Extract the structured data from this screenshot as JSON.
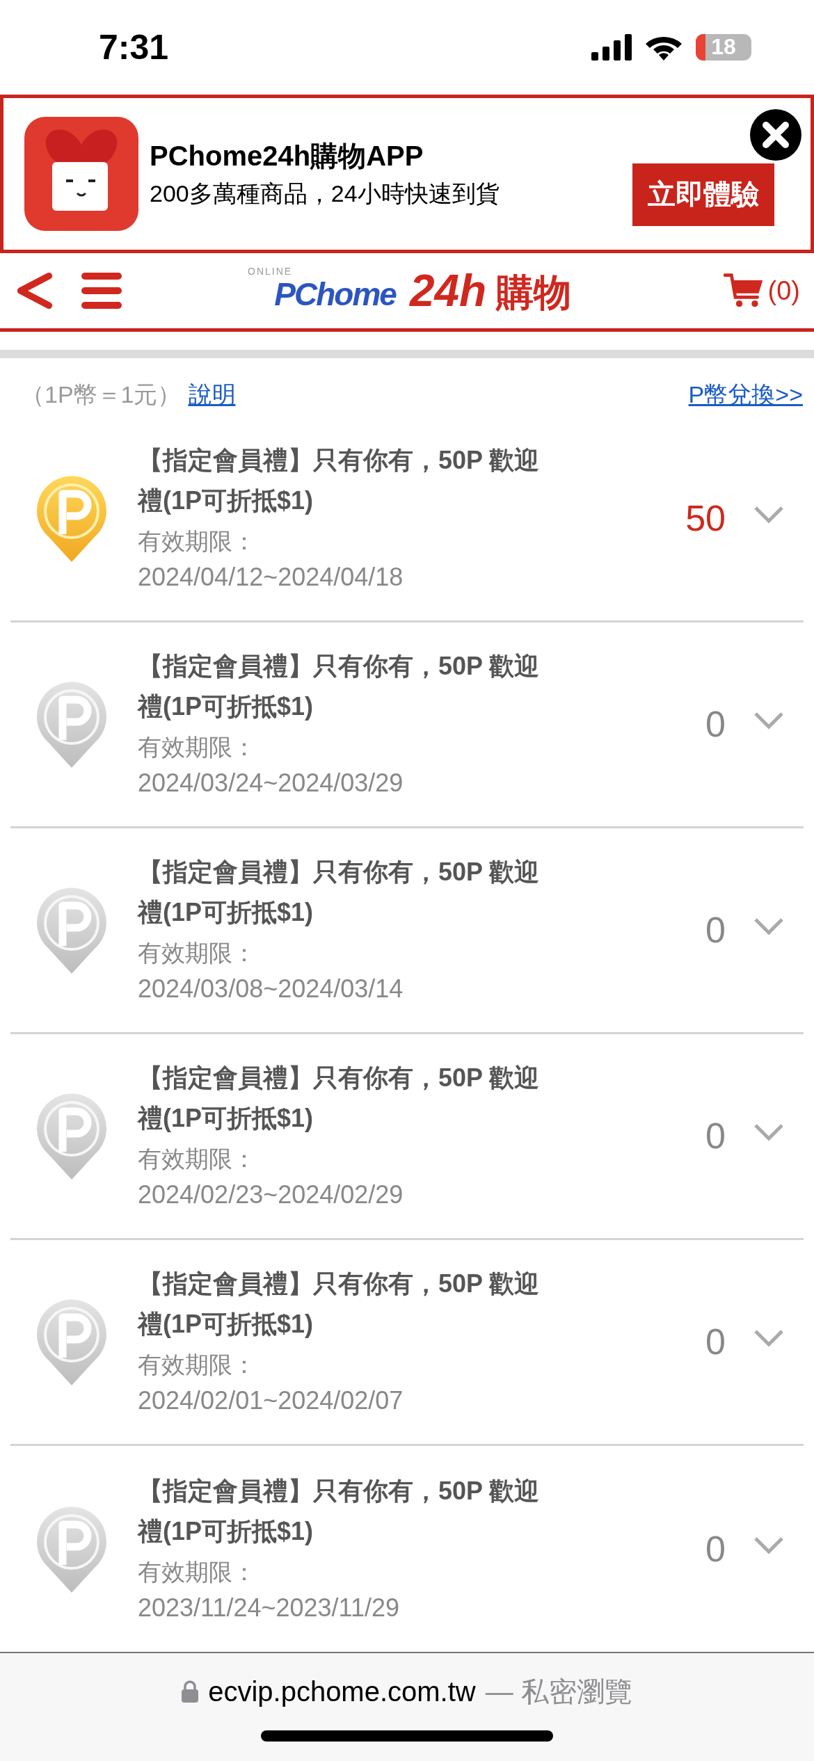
{
  "status_bar": {
    "time": "7:31",
    "battery": "18"
  },
  "app_banner": {
    "title": "PChome24h購物APP",
    "subtitle": "200多萬種商品，24小時快速到貨",
    "button": "立即體驗"
  },
  "nav": {
    "logo": {
      "brand": "PChome",
      "tag": "ONLINE",
      "number": "24h",
      "suffix": "購物"
    },
    "cart_count": "(0)"
  },
  "info": {
    "rate": "（1P幣＝1元）",
    "help_link": "說明",
    "exchange_link": "P幣兌換>>"
  },
  "items": [
    {
      "title": "【指定會員禮】只有你有，50P 歡迎禮(1P可折抵$1)",
      "validity_label": "有效期限：",
      "dates": "2024/04/12~2024/04/18",
      "points": "50",
      "active": true
    },
    {
      "title": "【指定會員禮】只有你有，50P 歡迎禮(1P可折抵$1)",
      "validity_label": "有效期限：",
      "dates": "2024/03/24~2024/03/29",
      "points": "0",
      "active": false
    },
    {
      "title": "【指定會員禮】只有你有，50P 歡迎禮(1P可折抵$1)",
      "validity_label": "有效期限：",
      "dates": "2024/03/08~2024/03/14",
      "points": "0",
      "active": false
    },
    {
      "title": "【指定會員禮】只有你有，50P 歡迎禮(1P可折抵$1)",
      "validity_label": "有效期限：",
      "dates": "2024/02/23~2024/02/29",
      "points": "0",
      "active": false
    },
    {
      "title": "【指定會員禮】只有你有，50P 歡迎禮(1P可折抵$1)",
      "validity_label": "有效期限：",
      "dates": "2024/02/01~2024/02/07",
      "points": "0",
      "active": false
    },
    {
      "title": "【指定會員禮】只有你有，50P 歡迎禮(1P可折抵$1)",
      "validity_label": "有效期限：",
      "dates": "2023/11/24~2023/11/29",
      "points": "0",
      "active": false
    }
  ],
  "browser_bar": {
    "url": "ecvip.pchome.com.tw",
    "mode": "— 私密瀏覽"
  }
}
